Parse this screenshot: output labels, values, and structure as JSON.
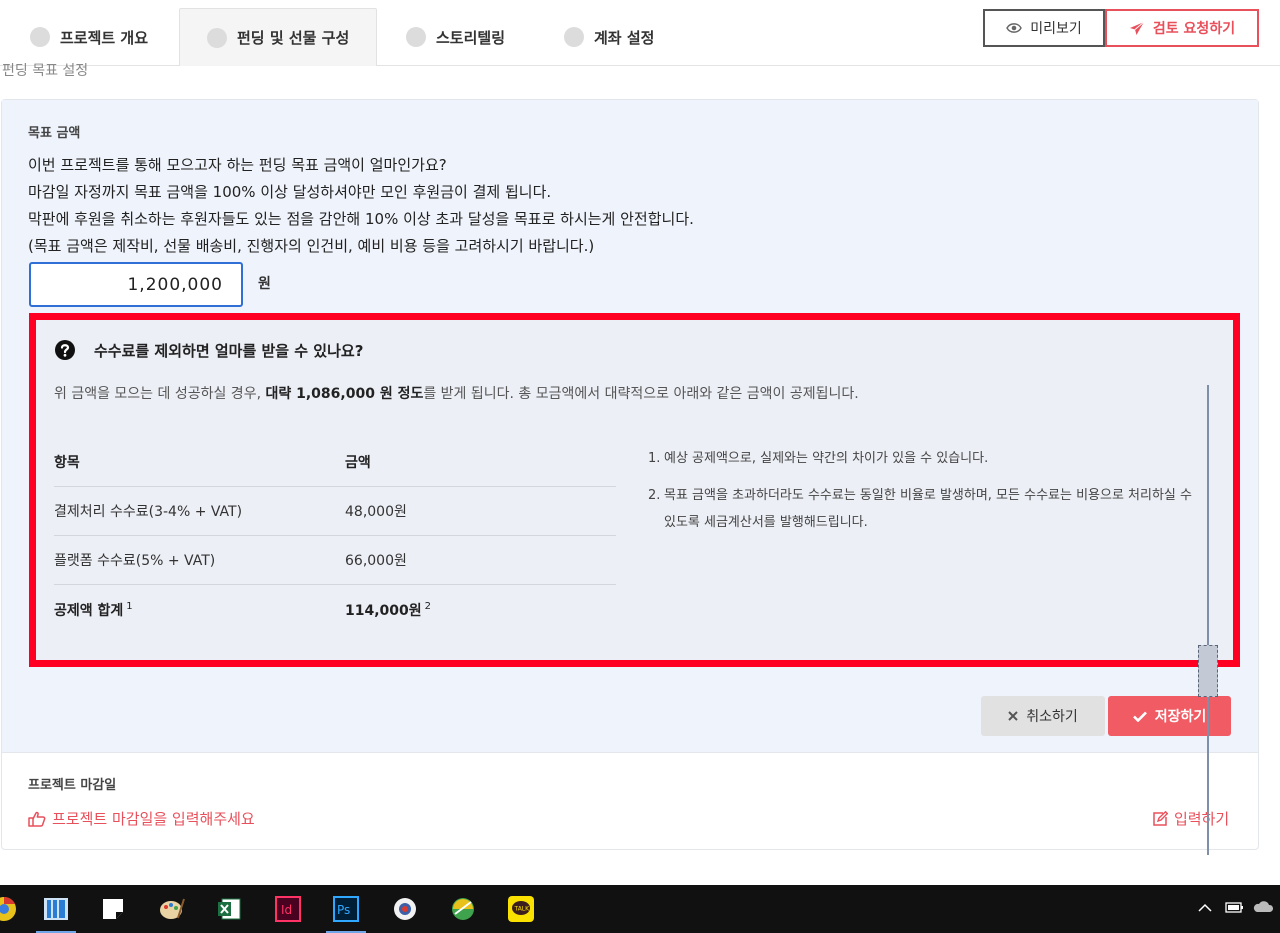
{
  "tabs": [
    {
      "label": "프로젝트 개요"
    },
    {
      "label": "펀딩 및 선물 구성"
    },
    {
      "label": "스토리텔링"
    },
    {
      "label": "계좌 설정"
    }
  ],
  "header": {
    "preview_label": "미리보기",
    "review_label": "검토 요청하기"
  },
  "section_crumb": "펀딩 목표 설정",
  "goal": {
    "label": "목표 금액",
    "lines": [
      "이번 프로젝트를 통해 모으고자 하는 펀딩 목표 금액이 얼마인가요?",
      "마감일 자정까지 목표 금액을 100% 이상 달성하셔야만 모인 후원금이 결제 됩니다.",
      "막판에 후원을 취소하는 후원자들도 있는 점을 감안해 10% 이상 초과 달성을 목표로 하시는게 안전합니다.",
      "(목표 금액은 제작비, 선물 배송비, 진행자의 인건비, 예비 비용 등을 고려하시기 바랍니다.)"
    ],
    "amount_value": "1,200,000",
    "unit": "원"
  },
  "fee_box": {
    "title": "수수료를 제외하면 얼마를 받을 수 있나요?",
    "sub_prefix": "위 금액을 모으는 데 성공하실 경우, ",
    "sub_bold": "대략 1,086,000 원 정도",
    "sub_suffix": "를 받게 됩니다. 총 모금액에서 대략적으로 아래와 같은 금액이 공제됩니다.",
    "table": {
      "headers": [
        "항목",
        "금액"
      ],
      "rows": [
        {
          "item": "결제처리 수수료(3-4% + VAT)",
          "amount": "48,000원"
        },
        {
          "item": "플랫폼 수수료(5% + VAT)",
          "amount": "66,000원"
        }
      ],
      "total": {
        "item": "공제액 합계",
        "item_sup": "1",
        "amount": "114,000원",
        "amount_sup": "2"
      }
    },
    "notes": [
      {
        "num": "1.",
        "text": "예상 공제액으로, 실제와는 약간의 차이가 있을 수 있습니다."
      },
      {
        "num": "2.",
        "text": "목표 금액을 초과하더라도 수수료는 동일한 비율로 발생하며, 모든 수수료는 비용으로 처리하실 수 있도록 세금계산서를 발행해드립니다."
      }
    ]
  },
  "actions": {
    "cancel_label": "취소하기",
    "save_label": "저장하기"
  },
  "deadline": {
    "label": "프로젝트 마감일",
    "prompt": "프로젝트 마감일을 입력해주세요",
    "enter_label": "입력하기"
  },
  "colors": {
    "accent": "#e8505b",
    "highlight": "#ff0022",
    "input_border": "#2f6fd6",
    "taskbar": "#111111"
  },
  "taskbar_icons": [
    "chrome-icon",
    "file-explorer-icon",
    "sticky-notes-icon",
    "paint-icon",
    "excel-icon",
    "indesign-icon",
    "photoshop-icon",
    "app-icon",
    "app-icon",
    "kakaotalk-icon"
  ]
}
